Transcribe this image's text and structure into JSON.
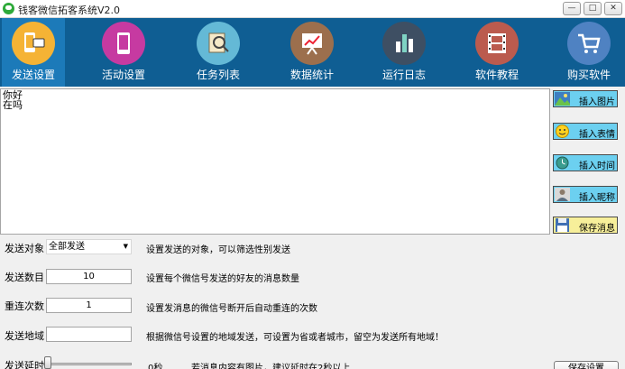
{
  "window": {
    "title": "钱客微信拓客系统V2.0",
    "min_glyph": "—",
    "max_glyph": "□",
    "close_glyph": "✕"
  },
  "toolbar": {
    "items": [
      {
        "label": "发送设置",
        "icon": "phone-send-icon",
        "color": "#f5b335"
      },
      {
        "label": "活动设置",
        "icon": "smartphone-icon",
        "color": "#c63aa1"
      },
      {
        "label": "任务列表",
        "icon": "magnifier-document-icon",
        "color": "#64b9d6"
      },
      {
        "label": "数据统计",
        "icon": "presentation-chart-icon",
        "color": "#9c6f4d"
      },
      {
        "label": "运行日志",
        "icon": "bar-chart-icon",
        "color": "#3e4f63"
      },
      {
        "label": "软件教程",
        "icon": "film-strip-icon",
        "color": "#bb5b4e"
      },
      {
        "label": "购买软件",
        "icon": "shopping-cart-icon",
        "color": "#4f82c2"
      }
    ]
  },
  "message": {
    "content": "你好\n在吗"
  },
  "insert_buttons": [
    {
      "label": "插入图片",
      "icon": "picture-icon"
    },
    {
      "label": "插入表情",
      "icon": "smiley-icon"
    },
    {
      "label": "插入时间",
      "icon": "clock-icon"
    },
    {
      "label": "插入昵称",
      "icon": "avatar-icon"
    },
    {
      "label": "保存消息",
      "icon": "floppy-icon"
    }
  ],
  "settings": {
    "target": {
      "label": "发送对象",
      "value": "全部发送",
      "hint": "设置发送的对象，可以筛选性别发送"
    },
    "count": {
      "label": "发送数目",
      "value": "10",
      "hint": "设置每个微信号发送的好友的消息数量"
    },
    "retry": {
      "label": "重连次数",
      "value": "1",
      "hint": "设置发消息的微信号断开后自动重连的次数"
    },
    "region": {
      "label": "发送地域",
      "value": "",
      "hint": "根据微信号设置的地域发送，可设置为省或者城市，留空为发送所有地域！"
    },
    "delay": {
      "label": "发送延时",
      "value": "0秒",
      "hint": "若消息内容有图片，建议延时在2秒以上",
      "level": 0
    }
  },
  "save_settings_label": "保存设置"
}
